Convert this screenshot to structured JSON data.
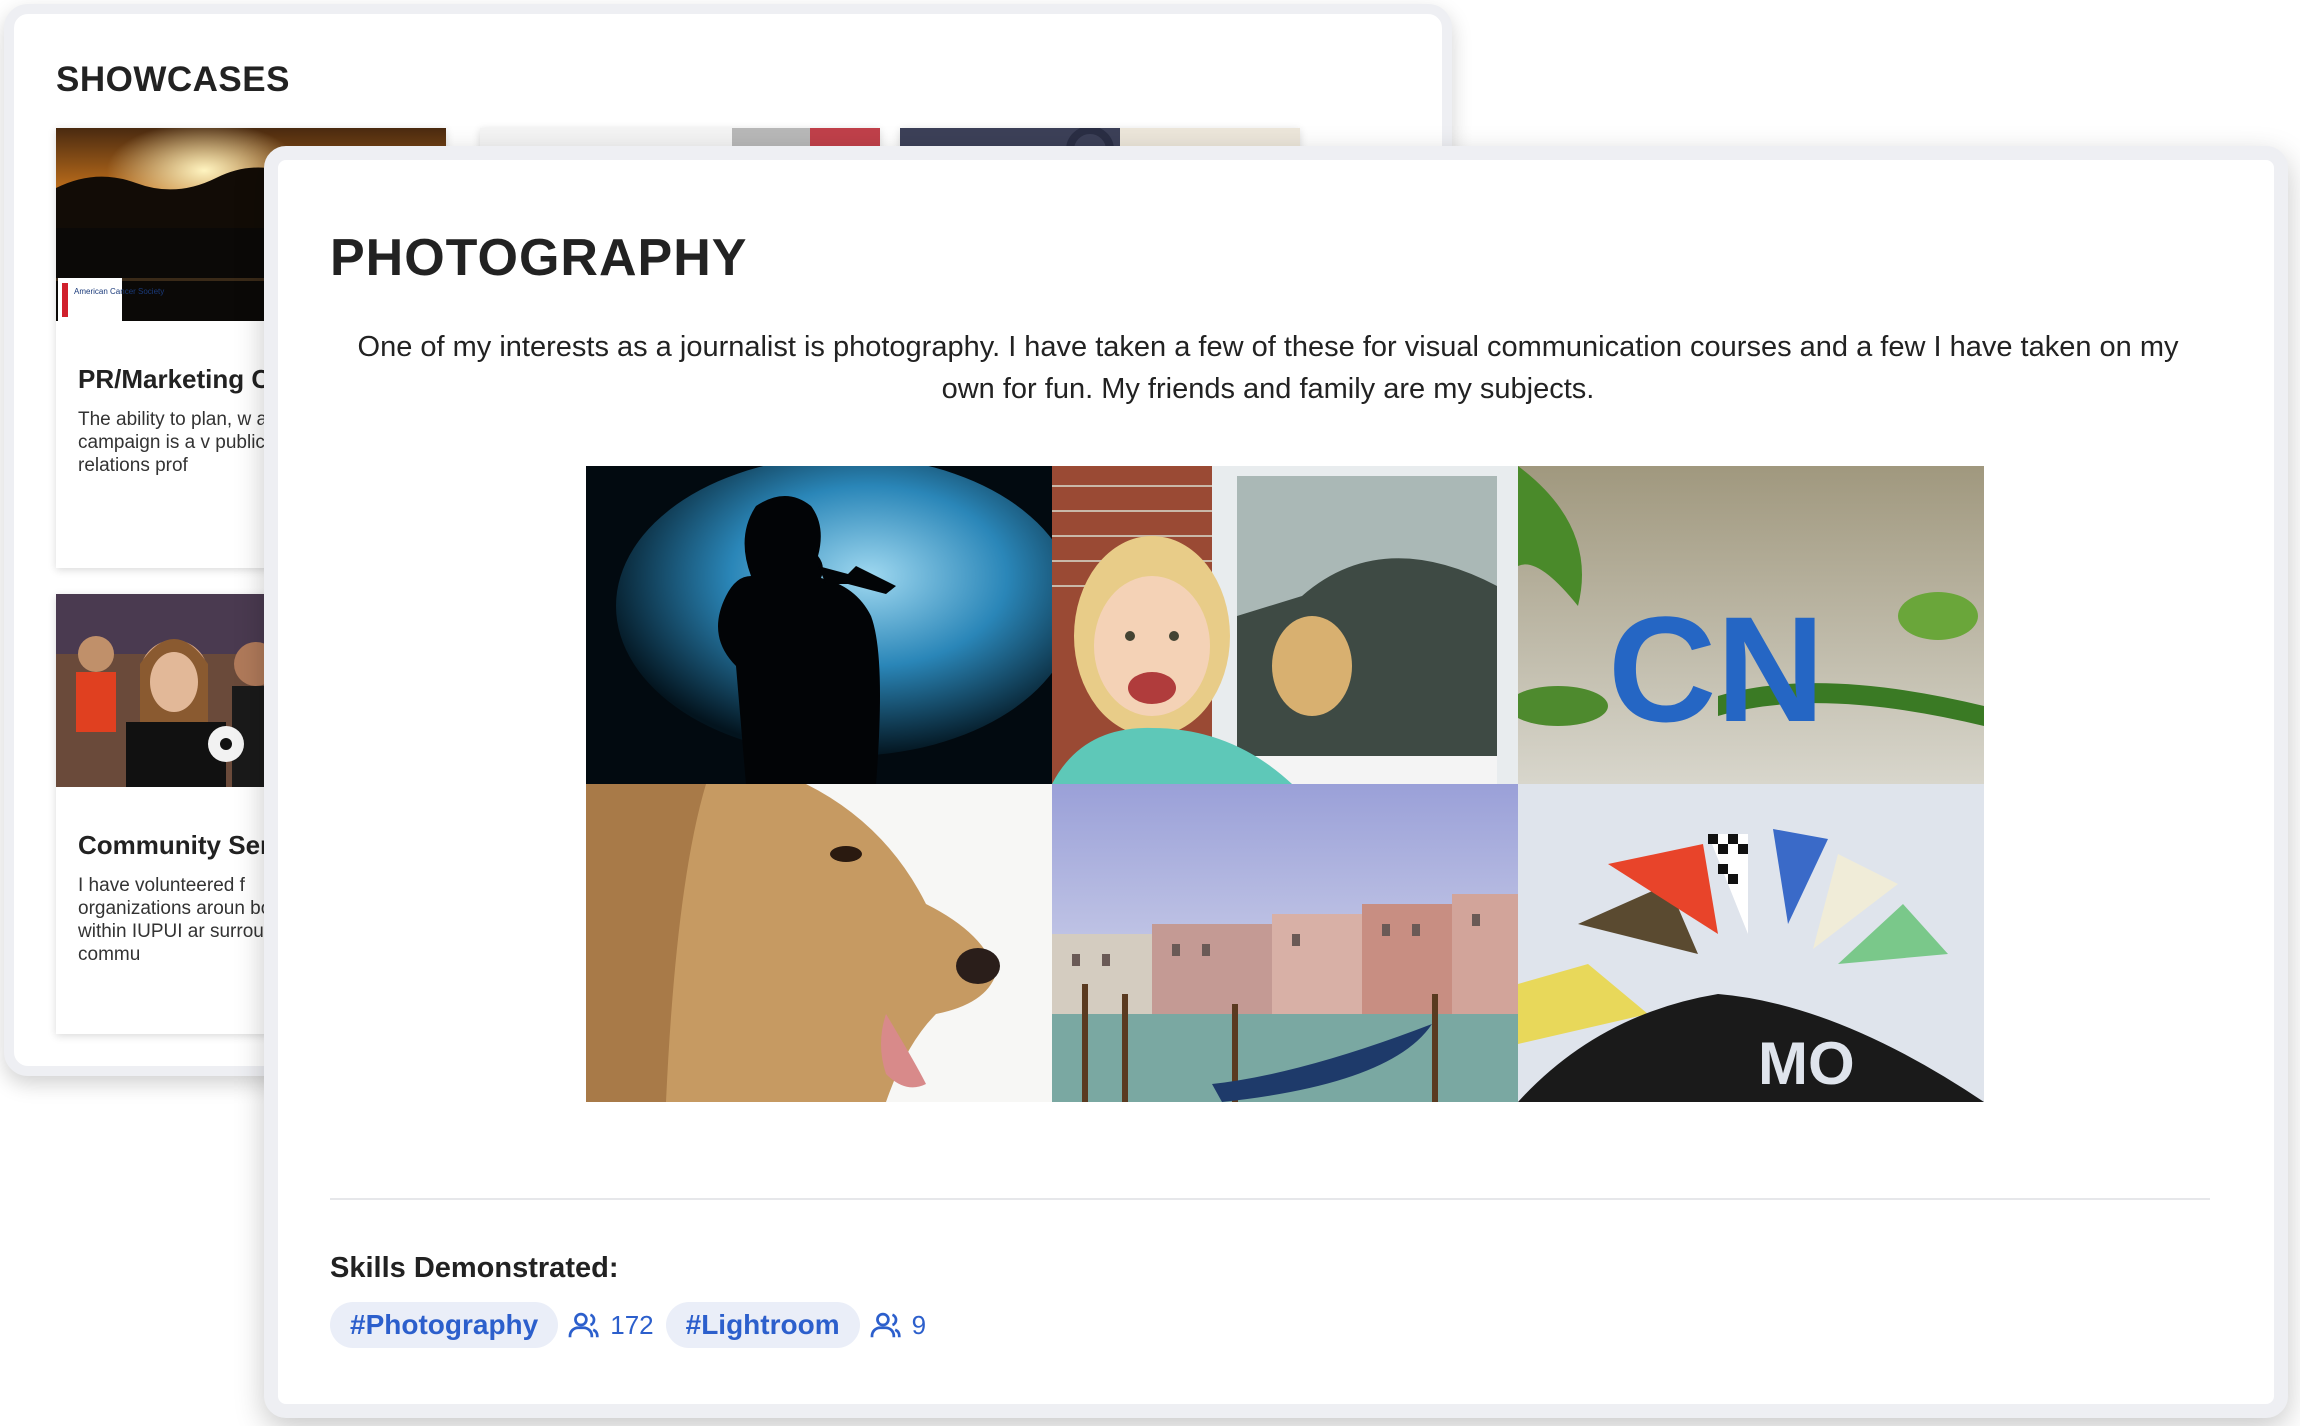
{
  "showcases": {
    "title": "SHOWCASES",
    "items": [
      {
        "title": "PR/Marketing C",
        "description": "The ability to plan, w a PR campaign is a v public relations prof",
        "logo_text": "American Cancer Society"
      },
      {
        "title": "Community Ser",
        "description": "I have volunteered f organizations aroun both within IUPUI ar surrounding commu"
      }
    ]
  },
  "photography": {
    "title": "PHOTOGRAPHY",
    "intro": "One of my interests as a journalist is photography. I have taken a few of these for visual communication courses and a few I have taken on my own for fun. My friends and family are my subjects.",
    "photos": [
      "singer-silhouette-photo",
      "smiling-girl-photo",
      "cn-letters-photo",
      "golden-retriever-photo",
      "venice-canal-photo",
      "racing-flags-photo"
    ],
    "photo_text": {
      "cn": "CN",
      "flag": "MO"
    }
  },
  "skills": {
    "label": "Skills Demonstrated:",
    "items": [
      {
        "tag": "#Photography",
        "count": "172"
      },
      {
        "tag": "#Lightroom",
        "count": "9"
      }
    ]
  },
  "colors": {
    "accent": "#2c5fcc",
    "tag_bg": "#eaeef8",
    "card_border": "#eeeff3"
  }
}
